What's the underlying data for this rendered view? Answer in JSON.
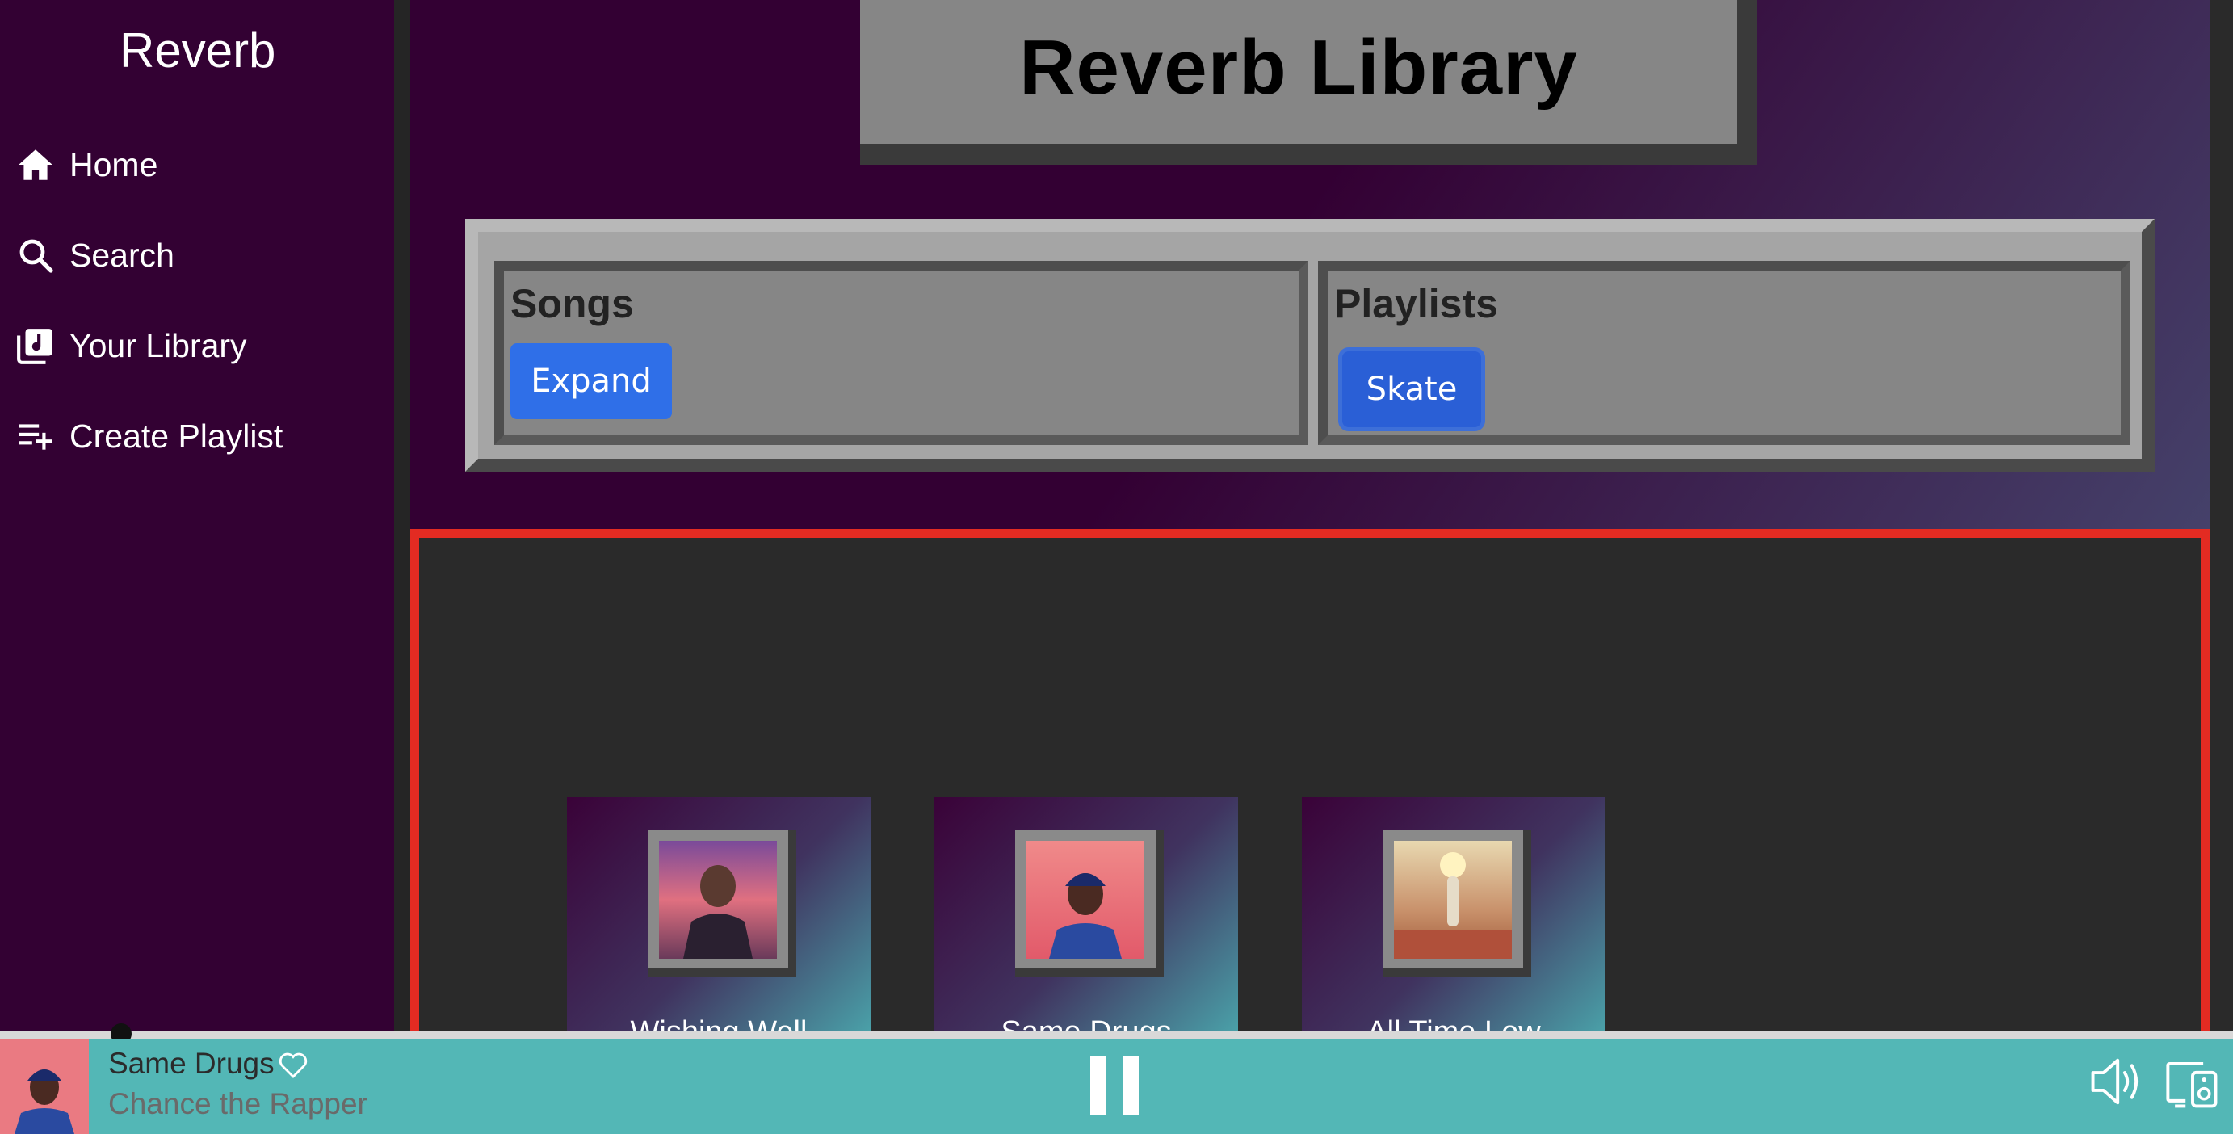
{
  "app": {
    "brand": "Reverb"
  },
  "sidebar": {
    "items": [
      {
        "label": "Home",
        "icon": "home-icon"
      },
      {
        "label": "Search",
        "icon": "search-icon"
      },
      {
        "label": "Your Library",
        "icon": "library-icon"
      },
      {
        "label": "Create Playlist",
        "icon": "playlist-add-icon"
      }
    ]
  },
  "header": {
    "title": "Reverb Library"
  },
  "panels": {
    "songs": {
      "title": "Songs",
      "button": "Expand"
    },
    "playlists": {
      "title": "Playlists",
      "button": "Skate"
    }
  },
  "cards": [
    {
      "title": "Wishing Well"
    },
    {
      "title": "Same Drugs"
    },
    {
      "title": "All Time Low"
    }
  ],
  "player": {
    "song": "Same Drugs",
    "artist": "Chance the Rapper",
    "progress": 0.05
  },
  "colors": {
    "sidebar": "#330133",
    "accent_button": "#2f6fe8",
    "content_border": "#e32b22",
    "player_bar": "#53b7b6"
  }
}
